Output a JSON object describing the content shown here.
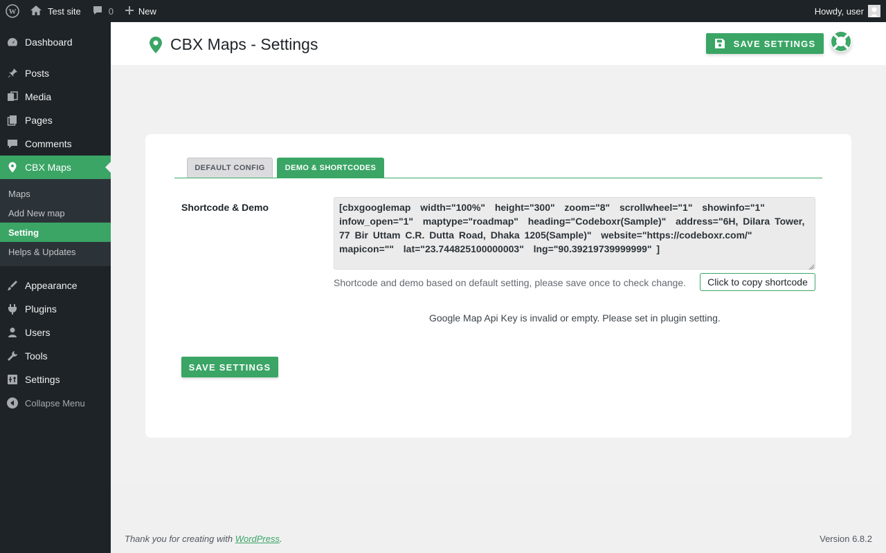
{
  "admin_bar": {
    "site_name": "Test site",
    "comments_count": "0",
    "new_label": "New",
    "greeting": "Howdy, user"
  },
  "sidebar": {
    "items": [
      {
        "label": "Dashboard",
        "icon": "dashboard-icon"
      },
      {
        "label": "Posts",
        "icon": "pin-icon"
      },
      {
        "label": "Media",
        "icon": "media-icon"
      },
      {
        "label": "Pages",
        "icon": "pages-icon"
      },
      {
        "label": "Comments",
        "icon": "comments-icon"
      },
      {
        "label": "CBX Maps",
        "icon": "map-marker-icon"
      },
      {
        "label": "Appearance",
        "icon": "brush-icon"
      },
      {
        "label": "Plugins",
        "icon": "plugin-icon"
      },
      {
        "label": "Users",
        "icon": "users-icon"
      },
      {
        "label": "Tools",
        "icon": "wrench-icon"
      },
      {
        "label": "Settings",
        "icon": "settings-icon"
      }
    ],
    "submenu": [
      "Maps",
      "Add New map",
      "Setting",
      "Helps & Updates"
    ],
    "collapse_label": "Collapse Menu"
  },
  "page": {
    "title": "CBX Maps - Settings",
    "save_label": "SAVE SETTINGS",
    "tabs": [
      "DEFAULT CONFIG",
      "DEMO & SHORTCODES"
    ],
    "field_label": "Shortcode & Demo",
    "shortcode": "[cbxgooglemap  width=\"100%\"  height=\"300\"  zoom=\"8\"  scrollwheel=\"1\"  showinfo=\"1\"  infow_open=\"1\"  maptype=\"roadmap\"  heading=\"Codeboxr(Sample)\"  address=\"6H, Dilara Tower, 77 Bir Uttam C.R. Dutta Road, Dhaka 1205(Sample)\"  website=\"https://codeboxr.com/\"  mapicon=\"\"  lat=\"23.744825100000003\"  lng=\"90.39219739999999\" ]",
    "helper_text": "Shortcode and demo based on default setting, please save once to check change.",
    "copy_label": "Click to copy shortcode",
    "api_message": "Google Map Api Key is invalid or empty. Please set in plugin setting.",
    "save_bottom_label": "SAVE SETTINGS"
  },
  "footer": {
    "thanks_prefix": "Thank you for creating with ",
    "thanks_link": "WordPress",
    "thanks_suffix": ".",
    "version": "Version 6.8.2"
  },
  "colors": {
    "accent": "#3aa565",
    "admin_dark": "#1d2327",
    "submenu_bg": "#2c3338"
  }
}
